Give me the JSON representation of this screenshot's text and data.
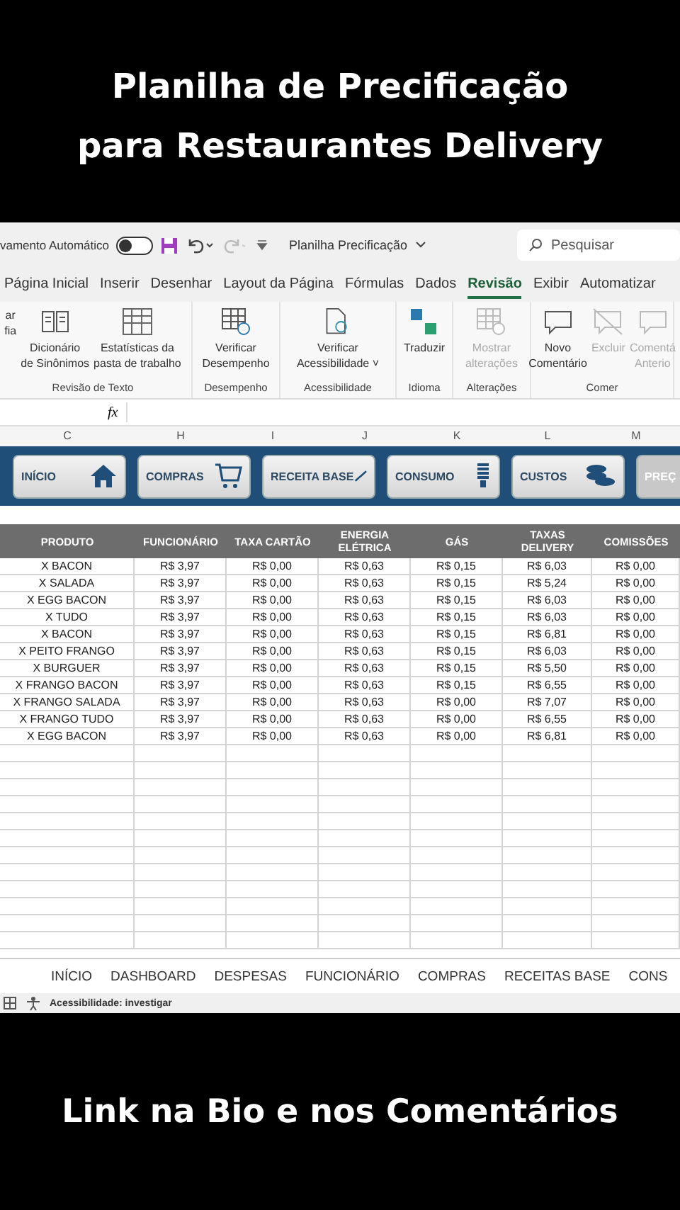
{
  "caption_top": [
    "Planilha de Precificação",
    "para Restaurantes Delivery"
  ],
  "title_bar": {
    "autosave_label": "vamento Automático",
    "autosave_on": false,
    "file_name": "Planilha Precificação",
    "search": {
      "placeholder": "Pesquisar"
    }
  },
  "ribbon_tabs": [
    {
      "label": "Página Inicial",
      "selected": false
    },
    {
      "label": "Inserir",
      "selected": false
    },
    {
      "label": "Desenhar",
      "selected": false
    },
    {
      "label": "Layout da Página",
      "selected": false
    },
    {
      "label": "Fórmulas",
      "selected": false
    },
    {
      "label": "Dados",
      "selected": false
    },
    {
      "label": "Revisão",
      "selected": true
    },
    {
      "label": "Exibir",
      "selected": false
    },
    {
      "label": "Automatizar",
      "selected": false
    }
  ],
  "ribbon_groups": [
    {
      "label": "Revisão de Texto",
      "buttons": [
        {
          "kind": "text",
          "lines": [
            "ar",
            "fia"
          ],
          "disabled": false
        },
        {
          "kind": "dictionary",
          "lines": [
            "Dicionário",
            "de Sinônimos"
          ],
          "disabled": false
        },
        {
          "kind": "statistics",
          "lines": [
            "Estatísticas da",
            "pasta de trabalho"
          ],
          "disabled": false
        }
      ]
    },
    {
      "label": "Desempenho",
      "buttons": [
        {
          "kind": "performance",
          "lines": [
            "Verificar",
            "Desempenho"
          ],
          "disabled": false
        }
      ]
    },
    {
      "label": "Acessibilidade",
      "buttons": [
        {
          "kind": "accessibility",
          "lines": [
            "Verificar",
            "Acessibilidade ˅"
          ],
          "disabled": false
        }
      ]
    },
    {
      "label": "Idioma",
      "buttons": [
        {
          "kind": "translate",
          "lines": [
            "Traduzir"
          ],
          "disabled": false
        }
      ]
    },
    {
      "label": "Alterações",
      "buttons": [
        {
          "kind": "performance",
          "lines": [
            "Mostrar",
            "alterações"
          ],
          "disabled": true
        }
      ]
    },
    {
      "label": "Comer",
      "buttons": [
        {
          "kind": "comment",
          "lines": [
            "Novo",
            "Comentário"
          ],
          "disabled": false
        },
        {
          "kind": "delete",
          "lines": [
            "Excluir"
          ],
          "disabled": true
        },
        {
          "kind": "comment",
          "lines": [
            "Comentá",
            "Anterio"
          ],
          "disabled": true
        }
      ]
    }
  ],
  "formula_bar": {
    "fx_label": "fx"
  },
  "column_letters": [
    "C",
    "H",
    "I",
    "J",
    "K",
    "L",
    "M"
  ],
  "nav_buttons": [
    {
      "label": "INÍCIO",
      "kind": "home"
    },
    {
      "label": "COMPRAS",
      "kind": "purchases"
    },
    {
      "label": "RECEITA BASE",
      "kind": "recipe"
    },
    {
      "label": "CONSUMO",
      "kind": "consumption"
    },
    {
      "label": "CUSTOS",
      "kind": "costs"
    },
    {
      "label": "PREÇ",
      "kind": "text"
    }
  ],
  "table": {
    "columns": [
      "PRODUTO",
      "FUNCIONÁRIO",
      "TAXA CARTÃO",
      "ENERGIA ELÉTRICA",
      "GÁS",
      "TAXAS DELIVERY",
      "COMISSÕES"
    ],
    "rows": [
      [
        "X BACON",
        "R$ 3,97",
        "R$ 0,00",
        "R$ 0,63",
        "R$ 0,15",
        "R$ 6,03",
        "R$ 0,00"
      ],
      [
        "X SALADA",
        "R$ 3,97",
        "R$ 0,00",
        "R$ 0,63",
        "R$ 0,15",
        "R$ 5,24",
        "R$ 0,00"
      ],
      [
        "X EGG BACON",
        "R$ 3,97",
        "R$ 0,00",
        "R$ 0,63",
        "R$ 0,15",
        "R$ 6,03",
        "R$ 0,00"
      ],
      [
        "X TUDO",
        "R$ 3,97",
        "R$ 0,00",
        "R$ 0,63",
        "R$ 0,15",
        "R$ 6,03",
        "R$ 0,00"
      ],
      [
        "X BACON",
        "R$ 3,97",
        "R$ 0,00",
        "R$ 0,63",
        "R$ 0,15",
        "R$ 6,81",
        "R$ 0,00"
      ],
      [
        "X PEITO FRANGO",
        "R$ 3,97",
        "R$ 0,00",
        "R$ 0,63",
        "R$ 0,15",
        "R$ 6,03",
        "R$ 0,00"
      ],
      [
        "X BURGUER",
        "R$ 3,97",
        "R$ 0,00",
        "R$ 0,63",
        "R$ 0,15",
        "R$ 5,50",
        "R$ 0,00"
      ],
      [
        "X  FRANGO BACON",
        "R$ 3,97",
        "R$ 0,00",
        "R$ 0,63",
        "R$ 0,15",
        "R$ 6,55",
        "R$ 0,00"
      ],
      [
        "X FRANGO SALADA",
        "R$ 3,97",
        "R$ 0,00",
        "R$ 0,63",
        "R$ 0,00",
        "R$ 7,07",
        "R$ 0,00"
      ],
      [
        "X FRANGO TUDO",
        "R$ 3,97",
        "R$ 0,00",
        "R$ 0,63",
        "R$ 0,00",
        "R$ 6,55",
        "R$ 0,00"
      ],
      [
        "X EGG BACON",
        "R$ 3,97",
        "R$ 0,00",
        "R$ 0,63",
        "R$ 0,00",
        "R$ 6,81",
        "R$ 0,00"
      ]
    ]
  },
  "sheet_tabs": [
    "INÍCIO",
    "DASHBOARD",
    "DESPESAS",
    "FUNCIONÁRIO",
    "COMPRAS",
    "RECEITAS BASE",
    "CONS"
  ],
  "status_bar": {
    "accessibility": "Acessibilidade: investigar"
  },
  "caption_bottom": "Link na Bio e nos Comentários"
}
